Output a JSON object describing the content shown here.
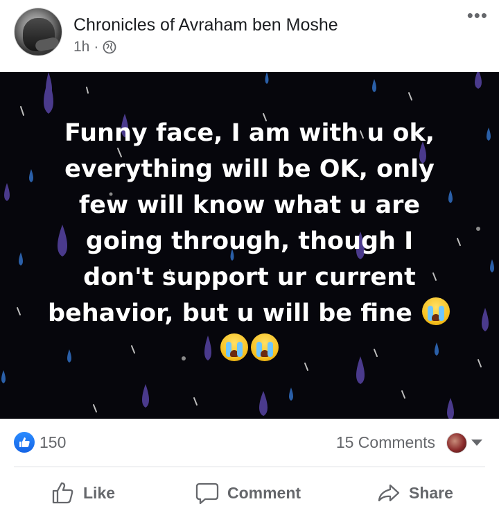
{
  "post": {
    "page_name": "Chronicles of Avraham ben Moshe",
    "time": "1h",
    "separator": "·",
    "privacy_icon": "globe-icon",
    "more_icon": "more-icon"
  },
  "image": {
    "line1": "Funny face, I am with u ok,",
    "line2": "everything will be OK, only",
    "line3": "few will know what u are",
    "line4": "going through, though I",
    "line5": "don't support ur current",
    "line6": "behavior, but u will be fine",
    "emoji": "loudly-crying-face",
    "background": "#06060c",
    "drop_colors": [
      "#4a3a8c",
      "#2a5fa8",
      "#cfcfcf"
    ]
  },
  "stats": {
    "likes": "150",
    "comments": "15 Comments",
    "like_color": "#1877f2"
  },
  "actions": {
    "like": "Like",
    "comment": "Comment",
    "share": "Share"
  }
}
